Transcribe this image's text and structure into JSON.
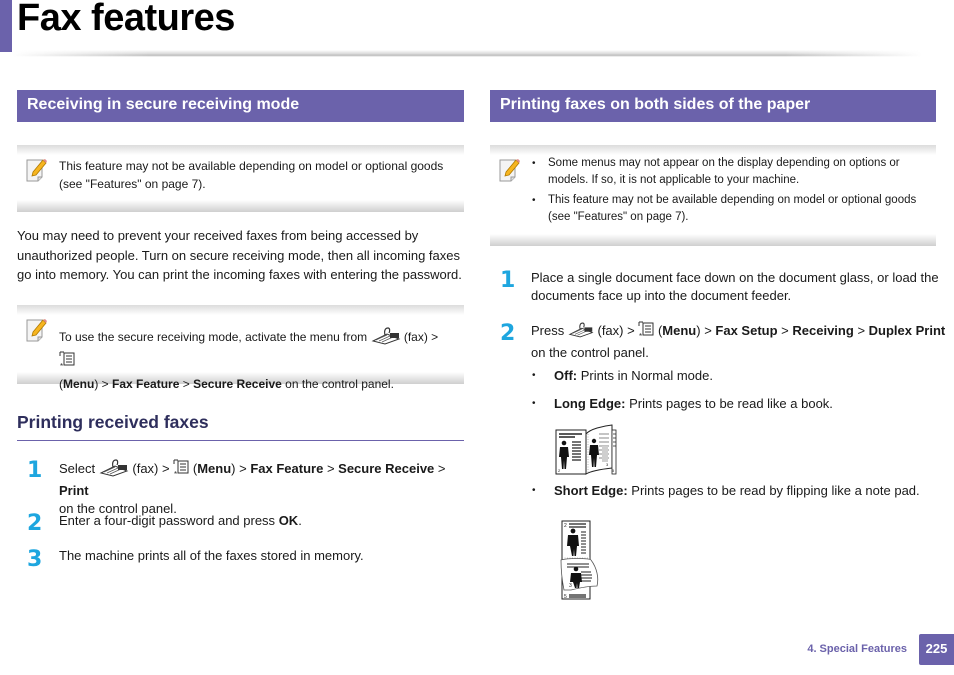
{
  "page": {
    "title": "Fax features",
    "accent_color": "#6b62ab",
    "step_color": "#1ea6df"
  },
  "left": {
    "section_title": "Receiving in secure receiving mode",
    "note1": "This feature may not be available depending on model or optional goods (see \"Features\" on page 7).",
    "intro": "You may need to prevent your received faxes from being accessed by unauthorized people. Turn on secure receiving mode, then all incoming faxes go into memory. You can print the incoming faxes with entering the password.",
    "note2": {
      "prefix": "To use the secure receiving mode, activate the menu from",
      "fax": "(fax) >",
      "paren_open": "(",
      "menu": "Menu",
      "paren_close": ") >",
      "item1": "Fax Feature",
      "sep": ">",
      "item2": "Secure Receive",
      "suffix": "on the control panel."
    },
    "subsection_title": "Printing received faxes",
    "steps": [
      {
        "num": "1",
        "select": "Select",
        "fax": "(fax) >",
        "paren_open": "(",
        "menu": "Menu",
        "paren_close": ") >",
        "item1": "Fax Feature",
        "sep1": ">",
        "item2": "Secure Receive",
        "sep2": ">",
        "item3": "Print",
        "line2": "on the control panel."
      },
      {
        "num": "2",
        "text": "Enter a four-digit password and press",
        "bold": "OK",
        "end": "."
      },
      {
        "num": "3",
        "text": "The machine prints all of the faxes stored in memory."
      }
    ]
  },
  "right": {
    "section_title": "Printing faxes on both sides of the paper",
    "note_items": [
      "Some menus may not appear on the display depending on options or models. If so, it is not applicable to your machine.",
      "This feature may not be available depending on model or optional goods (see \"Features\" on page 7)."
    ],
    "steps": [
      {
        "num": "1",
        "text": "Place a single document face down on the document glass, or load the documents face up into the document feeder."
      },
      {
        "num": "2",
        "press": "Press",
        "fax": "(fax) >",
        "paren_open": "(",
        "menu": "Menu",
        "paren_close": ") >",
        "item1": "Fax Setup",
        "sep1": ">",
        "item2": "Receiving",
        "sep2": ">",
        "item3": "Duplex Print",
        "line2": "on the control panel."
      }
    ],
    "options": [
      {
        "label": "Off:",
        "desc": "Prints in Normal mode."
      },
      {
        "label": "Long Edge:",
        "desc": "Prints pages to be read like a book."
      },
      {
        "label": "Short Edge:",
        "desc": "Prints pages to be read by flipping like a note pad."
      }
    ]
  },
  "footer": {
    "chapter": "4.  Special Features",
    "page_number": "225"
  }
}
